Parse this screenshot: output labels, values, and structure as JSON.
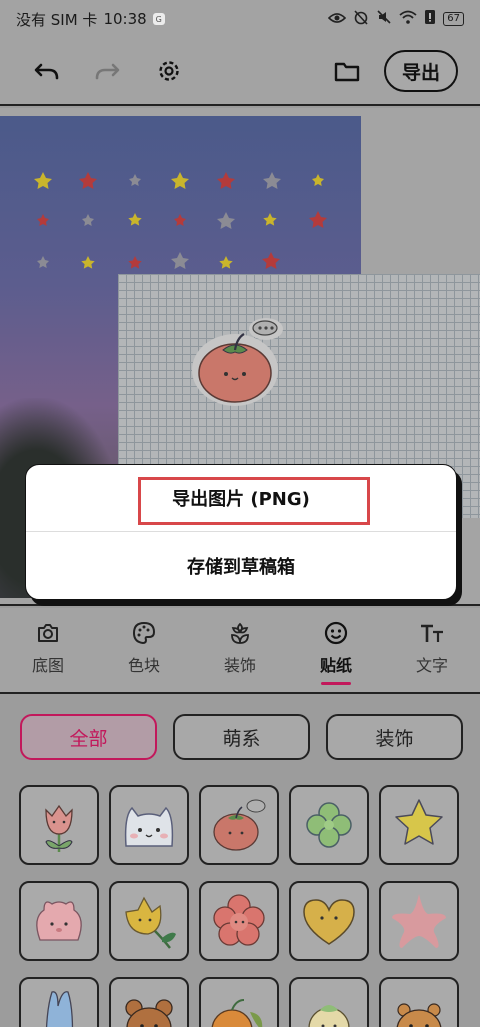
{
  "status_bar": {
    "carrier": "没有 SIM 卡",
    "time": "10:38",
    "app_icon": "G",
    "battery": "67"
  },
  "toolbar": {
    "undo_icon": "undo-icon",
    "redo_icon": "redo-icon",
    "settings_icon": "gear-icon",
    "folder_icon": "folder-icon",
    "export_label": "导出"
  },
  "dialog": {
    "export_png": "导出图片 (PNG)",
    "save_draft": "存储到草稿箱",
    "highlight_color": "#d8474a"
  },
  "tabs": [
    {
      "label": "底图",
      "icon": "camera-icon"
    },
    {
      "label": "色块",
      "icon": "palette-icon"
    },
    {
      "label": "装饰",
      "icon": "flower-icon"
    },
    {
      "label": "贴纸",
      "icon": "smiley-icon",
      "active": true
    },
    {
      "label": "文字",
      "icon": "text-size-icon"
    }
  ],
  "filters": [
    {
      "label": "全部",
      "active": true
    },
    {
      "label": "萌系"
    },
    {
      "label": "装饰"
    }
  ],
  "accent_color": "#c2185b",
  "stickers": [
    "tulip-sticker",
    "cat-face-sticker",
    "tomato-sticker",
    "clover-sticker",
    "star-sticker",
    "bunny-face-sticker",
    "yellow-tulip-sticker",
    "pink-flower-sticker",
    "heart-sticker",
    "pink-star-sticker",
    "blue-bunny-sticker",
    "bear-sticker",
    "orange-fruit-sticker",
    "chick-sticker",
    "hamster-sticker"
  ]
}
